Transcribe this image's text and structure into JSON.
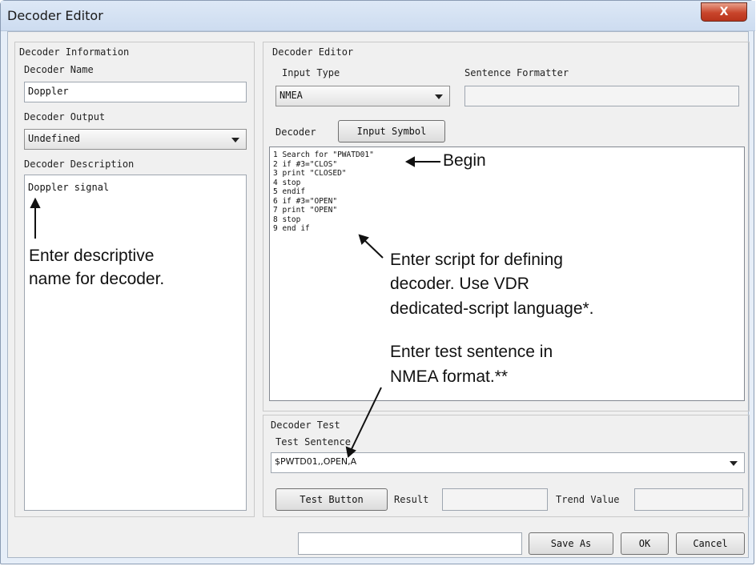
{
  "window": {
    "title": "Decoder Editor",
    "close_glyph": "X"
  },
  "info_group": {
    "title": "Decoder Information",
    "name_label": "Decoder Name",
    "name_value": "Doppler",
    "output_label": "Decoder Output",
    "output_value": "Undefined",
    "description_label": "Decoder Description",
    "description_value": "Doppler signal"
  },
  "editor_group": {
    "title": "Decoder Editor",
    "input_type_label": "Input Type",
    "input_type_value": "NMEA",
    "formatter_label": "Sentence Formatter",
    "formatter_value": "",
    "decoder_label": "Decoder",
    "input_symbol_button": "Input Symbol",
    "script_lines": [
      "1 Search for \"PWATD01\"",
      "2 if #3=\"CLOS\"",
      "3 print \"CLOSED\"",
      "4 stop",
      "5 endif",
      "6 if #3=\"OPEN\"",
      "7 print \"OPEN\"",
      "8 stop",
      "9 end if"
    ]
  },
  "test_group": {
    "title": "Decoder Test",
    "sentence_label": "Test Sentence",
    "sentence_value": "$PWTD01,,OPEN,A",
    "test_button": "Test Button",
    "result_label": "Result",
    "result_value": "",
    "trend_label": "Trend Value",
    "trend_value": ""
  },
  "footer": {
    "file_field_value": "",
    "save_as_button": "Save As",
    "ok_button": "OK",
    "cancel_button": "Cancel"
  },
  "annotations": {
    "begin": "Begin",
    "descriptive_line1": "Enter descriptive",
    "descriptive_line2": "name for decoder.",
    "script_line1": "Enter script for defining",
    "script_line2": "decoder. Use VDR",
    "script_line3": "dedicated-script language*.",
    "test_line1": "Enter test sentence in",
    "test_line2": "NMEA format.**"
  }
}
